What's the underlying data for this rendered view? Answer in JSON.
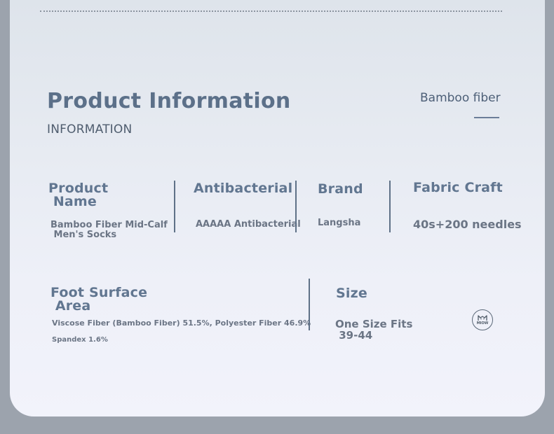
{
  "header": {
    "title": "Product Information",
    "subtitle": "INFORMATION",
    "tag": "Bamboo fiber"
  },
  "specs": {
    "product_name": {
      "label": "Product\n Name",
      "value": "Bamboo Fiber Mid-Calf\n Men's Socks"
    },
    "antibacterial": {
      "label": "Antibacterial",
      "value": "AAAAA Antibacterial"
    },
    "brand": {
      "label": "Brand",
      "value": "Langsha"
    },
    "fabric_craft": {
      "label": "Fabric Craft",
      "value": "40s+200 needles"
    },
    "foot_surface": {
      "label": "Foot Surface\n Area",
      "value": "Viscose Fiber (Bamboo Fiber) 51.5%, Polyester Fiber 46.9%",
      "value_extra": "Spandex 1.6%"
    },
    "size": {
      "label": "Size",
      "value": "One Size Fits\n 39-44"
    }
  },
  "logo": {
    "icon": "cat-logo-icon",
    "text": "MIOW"
  },
  "colors": {
    "title": "#5c7089",
    "label": "#617690",
    "divider": "#5f7187"
  }
}
